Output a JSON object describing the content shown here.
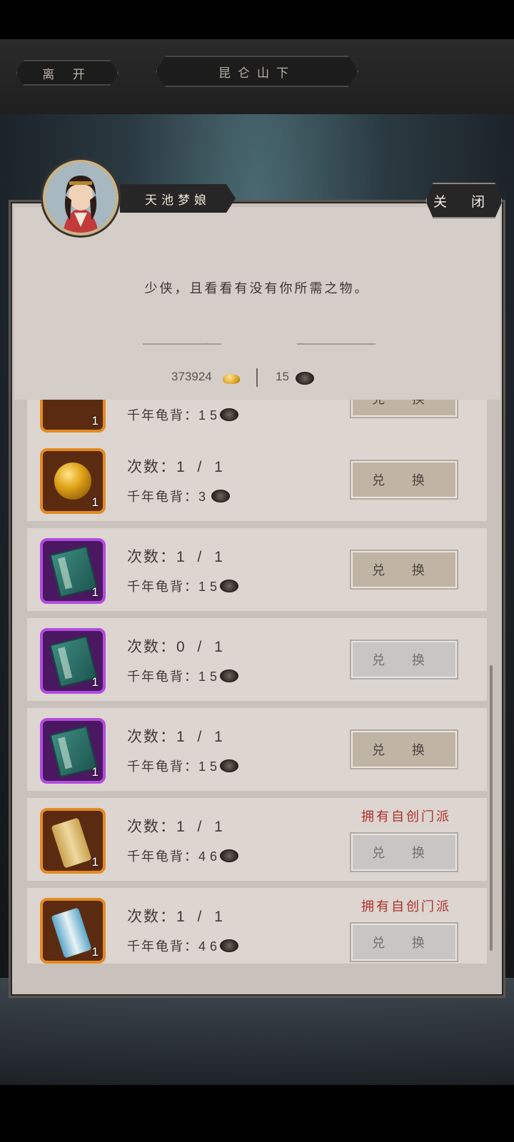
{
  "topbar": {
    "leave_label": "离 开",
    "location": "昆仑山下"
  },
  "npc": {
    "name": "天池梦娘",
    "dialogue": "少侠，且看看有没有你所需之物。"
  },
  "close_label": "关 闭",
  "currency": {
    "gold": "373924",
    "shell": "15"
  },
  "labels": {
    "count_prefix": "次数：",
    "cost_prefix": "千年龟背：",
    "exchange": "兑 换",
    "own_sect": "拥有自创门派"
  },
  "items": [
    {
      "icon": "flower-item-icon",
      "rarity": "orange",
      "qty": "1",
      "count": "",
      "cost": "15",
      "button": "active",
      "warning": false
    },
    {
      "icon": "golden-orb-icon",
      "rarity": "orange",
      "qty": "1",
      "count": "1 / 1",
      "cost": "3",
      "button": "active",
      "warning": false
    },
    {
      "icon": "martial-manual-icon",
      "rarity": "purple",
      "qty": "1",
      "count": "1 / 1",
      "cost": "15",
      "button": "active",
      "warning": false
    },
    {
      "icon": "martial-manual-icon",
      "rarity": "purple",
      "qty": "1",
      "count": "0 / 1",
      "cost": "15",
      "button": "disabled",
      "warning": false
    },
    {
      "icon": "martial-manual-icon",
      "rarity": "purple",
      "qty": "1",
      "count": "1 / 1",
      "cost": "15",
      "button": "active",
      "warning": false
    },
    {
      "icon": "scroll-icon",
      "rarity": "orange",
      "qty": "1",
      "count": "1 / 1",
      "cost": "46",
      "button": "disabled",
      "warning": true
    },
    {
      "icon": "scroll-icon",
      "rarity": "orange",
      "qty": "1",
      "count": "1 / 1",
      "cost": "46",
      "button": "disabled",
      "warning": true
    }
  ]
}
